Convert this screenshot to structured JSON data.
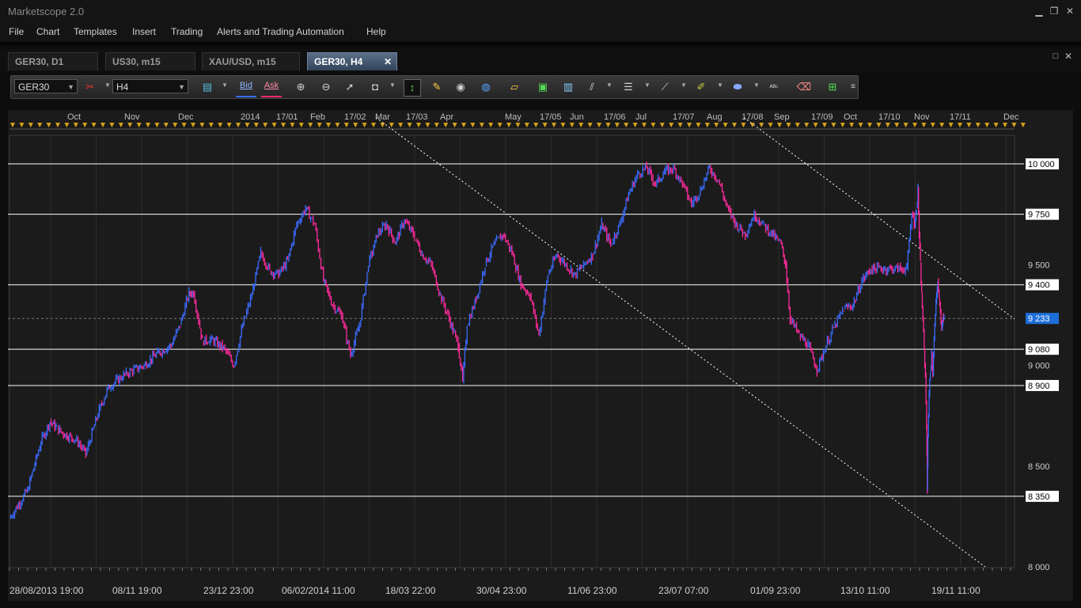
{
  "app": {
    "title": "Marketscope 2.0"
  },
  "window_controls": {
    "minimize": "▁",
    "restore": "❐",
    "close": "✕"
  },
  "menu": [
    "File",
    "Chart",
    "Templates",
    "Insert",
    "Trading",
    "Alerts and Trading Automation",
    "Help"
  ],
  "tabs": [
    {
      "label": "GER30, D1",
      "active": false
    },
    {
      "label": "US30, m15",
      "active": false
    },
    {
      "label": "XAU/USD, m15",
      "active": false
    },
    {
      "label": "GER30, H4",
      "active": true
    }
  ],
  "tab_close": "✕",
  "panel_controls": {
    "maximize": "□",
    "close": "✕"
  },
  "toolbar": {
    "instrument": "GER30",
    "timeframe": "H4",
    "bid_label": "Bid",
    "ask_label": "Ask",
    "icons": [
      "chart-type-icon",
      "crosshair-icon",
      "zoom-in-icon",
      "zoom-out-icon",
      "pointer-icon",
      "select-icon",
      "cursor-icon",
      "note-icon",
      "eye-icon",
      "globe-icon",
      "ruler-icon",
      "indicator-icon",
      "chart-window-icon",
      "fibonacci-icon",
      "channel-icon",
      "trendline-icon",
      "pen-icon",
      "shape-icon",
      "text-abc-icon",
      "eraser-icon",
      "tree-icon",
      "properties-icon"
    ]
  },
  "colors": {
    "background": "#1b1b1b",
    "bull_candle": "#3a6cff",
    "bear_candle": "#ff2a9c",
    "level_line": "#ffffff",
    "marker": "#d4a21c",
    "current_price_bg": "#1e6fd9"
  },
  "chart_data": {
    "type": "line",
    "instrument": "GER30",
    "timeframe": "H4",
    "top_axis_labels": [
      "Oct",
      "Nov",
      "Dec",
      "2014",
      "17/01",
      "Feb",
      "17/02",
      "Mar",
      "17/03",
      "Apr",
      "May",
      "17/05",
      "Jun",
      "17/06",
      "Jul",
      "17/07",
      "Aug",
      "17/08",
      "Sep",
      "17/09",
      "Oct",
      "17/10",
      "Nov",
      "17/11",
      "Dec"
    ],
    "bottom_axis_labels": [
      "28/08/2013 19:00",
      "08/11 19:00",
      "23/12 23:00",
      "06/02/2014 11:00",
      "18/03 22:00",
      "30/04 23:00",
      "11/06 23:00",
      "23/07 07:00",
      "01/09 23:00",
      "13/10 11:00",
      "19/11 11:00"
    ],
    "price_ticks": [
      {
        "value": 10000,
        "label": "10 000",
        "level": true
      },
      {
        "value": 9750,
        "label": "9 750",
        "level": true
      },
      {
        "value": 9500,
        "label": "9 500",
        "level": false
      },
      {
        "value": 9400,
        "label": "9 400",
        "level": true
      },
      {
        "value": 9080,
        "label": "9 080",
        "level": true
      },
      {
        "value": 9000,
        "label": "9 000",
        "level": false
      },
      {
        "value": 8900,
        "label": "8 900",
        "level": true
      },
      {
        "value": 8500,
        "label": "8 500",
        "level": false
      },
      {
        "value": 8350,
        "label": "8 350",
        "level": true
      },
      {
        "value": 8000,
        "label": "8 000",
        "level": false
      }
    ],
    "current_price": {
      "value": 9233,
      "label": "9 233"
    },
    "y_range": [
      8000,
      10000
    ],
    "price_path": [
      [
        0,
        8240
      ],
      [
        0.02,
        8380
      ],
      [
        0.035,
        8620
      ],
      [
        0.045,
        8720
      ],
      [
        0.06,
        8660
      ],
      [
        0.075,
        8630
      ],
      [
        0.085,
        8560
      ],
      [
        0.1,
        8780
      ],
      [
        0.11,
        8890
      ],
      [
        0.13,
        8960
      ],
      [
        0.15,
        9000
      ],
      [
        0.165,
        9060
      ],
      [
        0.18,
        9100
      ],
      [
        0.19,
        9200
      ],
      [
        0.2,
        9360
      ],
      [
        0.205,
        9360
      ],
      [
        0.215,
        9120
      ],
      [
        0.225,
        9130
      ],
      [
        0.24,
        9080
      ],
      [
        0.25,
        9000
      ],
      [
        0.26,
        9200
      ],
      [
        0.27,
        9350
      ],
      [
        0.28,
        9560
      ],
      [
        0.29,
        9470
      ],
      [
        0.3,
        9450
      ],
      [
        0.31,
        9520
      ],
      [
        0.32,
        9700
      ],
      [
        0.33,
        9780
      ],
      [
        0.34,
        9700
      ],
      [
        0.35,
        9420
      ],
      [
        0.36,
        9300
      ],
      [
        0.37,
        9250
      ],
      [
        0.38,
        9050
      ],
      [
        0.39,
        9200
      ],
      [
        0.4,
        9500
      ],
      [
        0.41,
        9650
      ],
      [
        0.42,
        9700
      ],
      [
        0.43,
        9610
      ],
      [
        0.44,
        9720
      ],
      [
        0.45,
        9650
      ],
      [
        0.46,
        9550
      ],
      [
        0.47,
        9500
      ],
      [
        0.48,
        9350
      ],
      [
        0.49,
        9230
      ],
      [
        0.5,
        9100
      ],
      [
        0.505,
        8920
      ],
      [
        0.51,
        9200
      ],
      [
        0.52,
        9330
      ],
      [
        0.53,
        9500
      ],
      [
        0.54,
        9600
      ],
      [
        0.55,
        9650
      ],
      [
        0.56,
        9560
      ],
      [
        0.57,
        9400
      ],
      [
        0.58,
        9350
      ],
      [
        0.59,
        9150
      ],
      [
        0.6,
        9450
      ],
      [
        0.61,
        9550
      ],
      [
        0.62,
        9500
      ],
      [
        0.63,
        9450
      ],
      [
        0.64,
        9500
      ],
      [
        0.65,
        9550
      ],
      [
        0.66,
        9700
      ],
      [
        0.67,
        9600
      ],
      [
        0.68,
        9700
      ],
      [
        0.69,
        9850
      ],
      [
        0.7,
        9950
      ],
      [
        0.71,
        9980
      ],
      [
        0.72,
        9900
      ],
      [
        0.73,
        9960
      ],
      [
        0.74,
        9980
      ],
      [
        0.75,
        9900
      ],
      [
        0.76,
        9800
      ],
      [
        0.77,
        9870
      ],
      [
        0.78,
        9980
      ],
      [
        0.79,
        9920
      ],
      [
        0.8,
        9780
      ],
      [
        0.81,
        9700
      ],
      [
        0.82,
        9650
      ],
      [
        0.83,
        9750
      ],
      [
        0.84,
        9700
      ],
      [
        0.85,
        9650
      ],
      [
        0.86,
        9600
      ],
      [
        0.865,
        9500
      ],
      [
        0.87,
        9230
      ],
      [
        0.88,
        9150
      ],
      [
        0.89,
        9100
      ],
      [
        0.9,
        8980
      ],
      [
        0.91,
        9100
      ],
      [
        0.92,
        9200
      ],
      [
        0.93,
        9280
      ],
      [
        0.94,
        9300
      ],
      [
        0.95,
        9420
      ],
      [
        0.96,
        9480
      ]
    ],
    "price_path_b": [
      [
        0,
        9480
      ],
      [
        0.02,
        9620
      ],
      [
        0.04,
        9760
      ],
      [
        0.06,
        9700
      ],
      [
        0.07,
        9720
      ],
      [
        0.08,
        9780
      ],
      [
        0.09,
        9880
      ],
      [
        0.1,
        9650
      ],
      [
        0.11,
        9500
      ],
      [
        0.12,
        9350
      ],
      [
        0.13,
        9230
      ],
      [
        0.14,
        9080
      ],
      [
        0.15,
        8950
      ],
      [
        0.16,
        8700
      ],
      [
        0.165,
        8380
      ],
      [
        0.17,
        8650
      ],
      [
        0.18,
        8850
      ],
      [
        0.19,
        8980
      ],
      [
        0.2,
        9050
      ],
      [
        0.21,
        8950
      ],
      [
        0.22,
        9130
      ],
      [
        0.23,
        9250
      ],
      [
        0.24,
        9350
      ],
      [
        0.25,
        9420
      ],
      [
        0.26,
        9320
      ],
      [
        0.27,
        9280
      ],
      [
        0.28,
        9180
      ],
      [
        0.29,
        9250
      ],
      [
        0.3,
        9233
      ]
    ],
    "trend_lines": [
      {
        "from": [
          "17/03",
          10230
        ],
        "to": [
          "Dec",
          8000
        ],
        "style": "dotted"
      },
      {
        "from": [
          "17/08",
          10230
        ],
        "to": [
          "Dec",
          9230
        ],
        "style": "dotted"
      }
    ]
  }
}
